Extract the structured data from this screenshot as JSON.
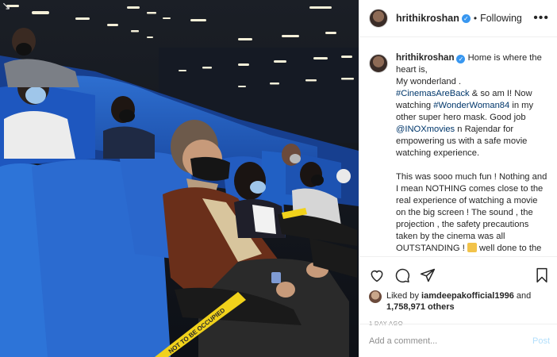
{
  "header": {
    "username": "hrithikroshan",
    "separator": "•",
    "follow_status": "Following",
    "more_icon": "more-dots-icon"
  },
  "caption": {
    "username": "hrithikroshan",
    "p1": [
      {
        "text": "Home is where the heart is,",
        "tag": false
      },
      {
        "text": "\nMy wonderland .\n",
        "tag": false
      },
      {
        "text": "#CinemasAreBack",
        "tag": true
      },
      {
        "text": " & so am I! Now watching ",
        "tag": false
      },
      {
        "text": "#WonderWoman84",
        "tag": true
      },
      {
        "text": " in my other super hero mask. Good job ",
        "tag": false
      },
      {
        "text": "@INOXmovies",
        "tag": true
      },
      {
        "text": " n Rajendar for empowering us with a safe movie watching experience.",
        "tag": false
      }
    ],
    "p2_before_emoji": "This was sooo much fun ! Nothing and I mean NOTHING comes close to the real experience of watching a movie on the big screen ! The sound , the projection , the safety precautions taken by the cinema was all OUTSTANDING !",
    "p2_after_emoji": " well done to the INOX team !",
    "emoji_icon": "hands-raised-emoji-icon"
  },
  "actions": {
    "like_icon": "heart-icon",
    "comment_icon": "comment-icon",
    "share_icon": "share-icon",
    "save_icon": "bookmark-icon",
    "liked_by_prefix": "Liked by ",
    "liked_by_user": "iamdeepakofficial1996",
    "liked_by_and": " and",
    "others_count": "1,758,971 others",
    "timestamp": "1 DAY AGO"
  },
  "comment": {
    "placeholder": "Add a comment...",
    "post_label": "Post"
  },
  "photo": {
    "corner_icon": "arrow-down-icon",
    "floor_tape_text": "NOT TO BE OCCUPIED"
  }
}
